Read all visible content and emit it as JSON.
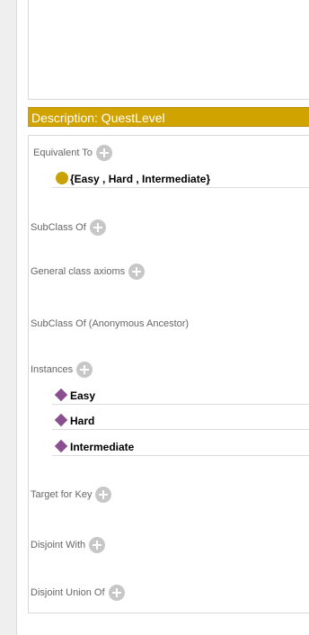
{
  "header": {
    "title": "Description: QuestLevel"
  },
  "sections": {
    "equivalent_to": {
      "label": "Equivalent To",
      "entries": [
        "{Easy , Hard , Intermediate}"
      ]
    },
    "subclass_of": {
      "label": "SubClass Of"
    },
    "general_axioms": {
      "label": "General class axioms"
    },
    "subclass_anon": {
      "label": "SubClass Of (Anonymous Ancestor)"
    },
    "instances": {
      "label": "Instances",
      "entries": [
        "Easy",
        "Hard",
        "Intermediate"
      ]
    },
    "target_key": {
      "label": "Target for Key"
    },
    "disjoint_with": {
      "label": "Disjoint With"
    },
    "disjoint_union": {
      "label": "Disjoint Union Of"
    }
  },
  "icons": {
    "add": "plus-circle-icon",
    "class_expression": "yellow-circle-icon",
    "individual": "purple-diamond-icon"
  },
  "colors": {
    "header_bg": "#d1a300",
    "class_icon": "#c9a100",
    "individual_icon": "#8a4f90",
    "add_button": "#c7c7c7"
  }
}
